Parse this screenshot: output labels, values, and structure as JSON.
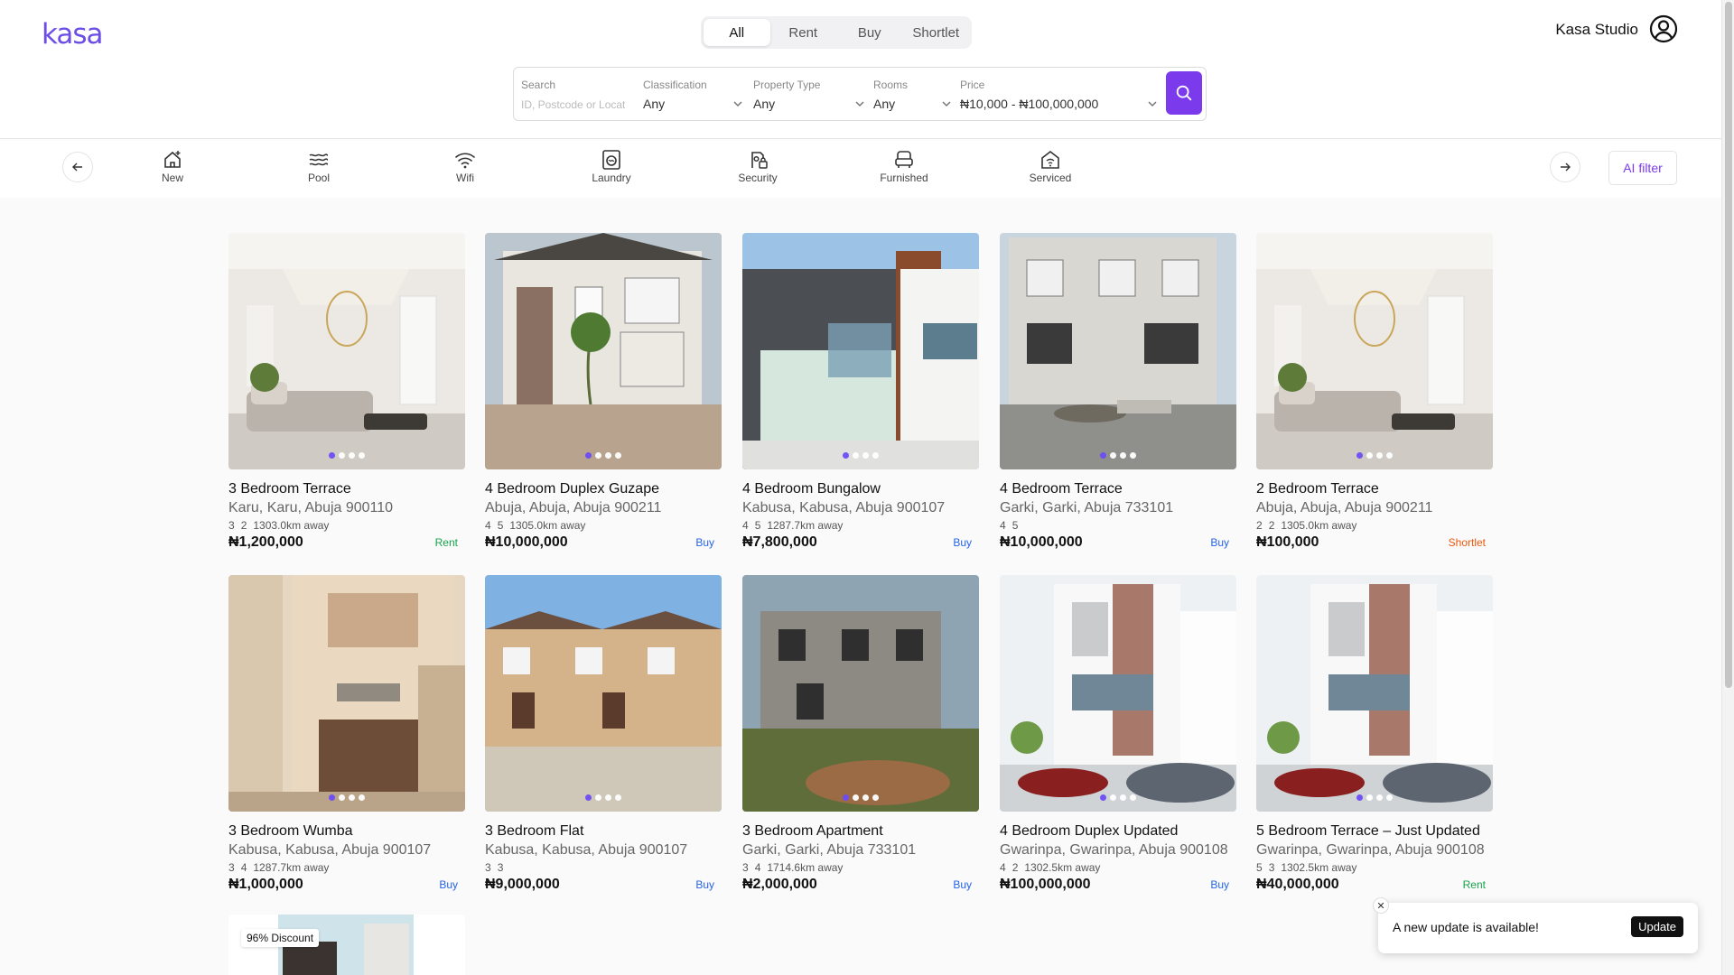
{
  "header": {
    "logo": "kasa",
    "tabs": [
      {
        "label": "All",
        "active": true
      },
      {
        "label": "Rent",
        "active": false
      },
      {
        "label": "Buy",
        "active": false
      },
      {
        "label": "Shortlet",
        "active": false
      }
    ],
    "studio_label": "Kasa Studio",
    "user_icon": "user-circle-icon"
  },
  "search": {
    "search_label": "Search",
    "search_placeholder": "ID, Postcode or Location",
    "classification_label": "Classification",
    "classification_value": "Any",
    "property_type_label": "Property Type",
    "property_type_value": "Any",
    "rooms_label": "Rooms",
    "rooms_value": "Any",
    "price_label": "Price",
    "price_value": "₦10,000 - ₦100,000,000",
    "button_icon": "search-icon"
  },
  "categories": [
    {
      "label": "New",
      "icon": "new-home-icon"
    },
    {
      "label": "Pool",
      "icon": "pool-icon"
    },
    {
      "label": "Wifi",
      "icon": "wifi-icon"
    },
    {
      "label": "Laundry",
      "icon": "laundry-icon"
    },
    {
      "label": "Security",
      "icon": "security-icon"
    },
    {
      "label": "Furnished",
      "icon": "furnished-icon"
    },
    {
      "label": "Serviced",
      "icon": "serviced-icon"
    }
  ],
  "ai_filter_label": "AI filter",
  "listings": [
    {
      "title": "3 Bedroom Terrace",
      "location": "Karu, Karu, Abuja 900110",
      "beds": "3",
      "baths": "2",
      "distance": "1303.0km away",
      "price": "₦1,200,000",
      "type": "Rent"
    },
    {
      "title": "4 Bedroom Duplex Guzape",
      "location": "Abuja, Abuja, Abuja 900211",
      "beds": "4",
      "baths": "5",
      "distance": "1305.0km away",
      "price": "₦10,000,000",
      "type": "Buy"
    },
    {
      "title": "4 Bedroom Bungalow",
      "location": "Kabusa, Kabusa, Abuja 900107",
      "beds": "4",
      "baths": "5",
      "distance": "1287.7km away",
      "price": "₦7,800,000",
      "type": "Buy"
    },
    {
      "title": "4 Bedroom Terrace",
      "location": "Garki, Garki, Abuja 733101",
      "beds": "4",
      "baths": "5",
      "distance": "",
      "price": "₦10,000,000",
      "type": "Buy"
    },
    {
      "title": "2 Bedroom Terrace",
      "location": "Abuja, Abuja, Abuja 900211",
      "beds": "2",
      "baths": "2",
      "distance": "1305.0km away",
      "price": "₦100,000",
      "type": "Shortlet"
    },
    {
      "title": "3 Bedroom Wumba",
      "location": "Kabusa, Kabusa, Abuja 900107",
      "beds": "3",
      "baths": "4",
      "distance": "1287.7km away",
      "price": "₦1,000,000",
      "type": "Buy"
    },
    {
      "title": "3 Bedroom Flat",
      "location": "Kabusa, Kabusa, Abuja 900107",
      "beds": "3",
      "baths": "3",
      "distance": "",
      "price": "₦9,000,000",
      "type": "Buy"
    },
    {
      "title": "3 Bedroom Apartment",
      "location": "Garki, Garki, Abuja 733101",
      "beds": "3",
      "baths": "4",
      "distance": "1714.6km away",
      "price": "₦2,000,000",
      "type": "Buy"
    },
    {
      "title": "4 Bedroom Duplex Updated",
      "location": "Gwarinpa, Gwarinpa, Abuja 900108",
      "beds": "4",
      "baths": "2",
      "distance": "1302.5km away",
      "price": "₦100,000,000",
      "type": "Buy"
    },
    {
      "title": "5 Bedroom Terrace – Just Updated",
      "location": "Gwarinpa, Gwarinpa, Abuja 900108",
      "beds": "5",
      "baths": "3",
      "distance": "1302.5km away",
      "price": "₦40,000,000",
      "type": "Rent"
    }
  ],
  "badge_colors": {
    "Rent": "#16a34a",
    "Buy": "#2563eb",
    "Shortlet": "#ea580c"
  },
  "partial_listing": {
    "discount": "96% Discount"
  },
  "toast": {
    "message": "A new update is available!",
    "button": "Update",
    "close_glyph": "✕"
  }
}
